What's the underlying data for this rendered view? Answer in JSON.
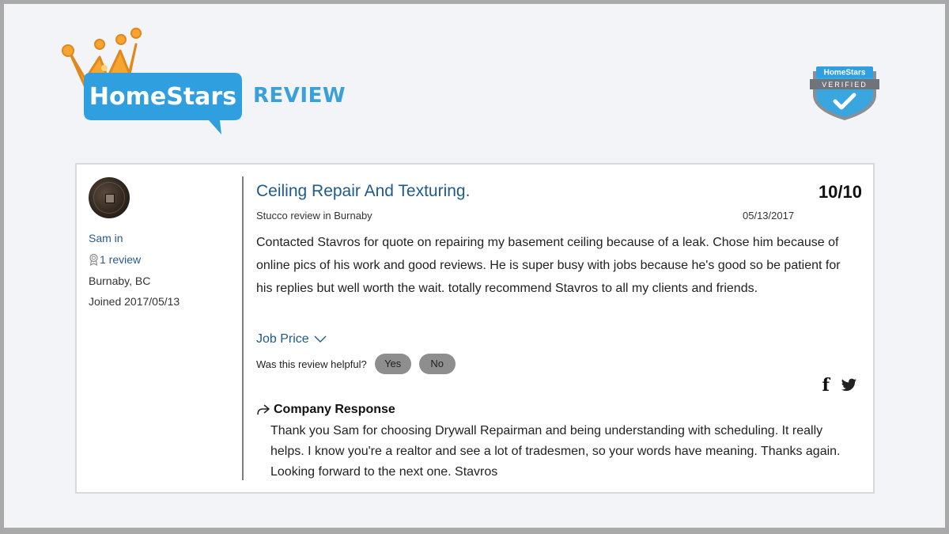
{
  "brand": {
    "logo_text": "HomeStars",
    "header_word": "REVIEW",
    "badge_top": "HomeStars",
    "badge_mid": "VERIFIED"
  },
  "reviewer": {
    "name": "Sam in",
    "review_count": "1 review",
    "location": "Burnaby, BC",
    "joined": "Joined 2017/05/13"
  },
  "review": {
    "title": "Ceiling Repair And Texturing.",
    "score": "10/10",
    "subline": "Stucco review in Burnaby",
    "date": "05/13/2017",
    "body": "Contacted Stavros for quote on repairing my basement ceiling because of a leak. Chose him because of online pics of his work and good reviews. He is super busy with jobs because he's good so be patient for his replies but well worth the wait. totally recommend Stavros to all my clients and friends.",
    "job_price_label": "Job Price",
    "helpful_question": "Was this review helpful?",
    "yes_label": "Yes",
    "no_label": "No",
    "share_facebook": "f"
  },
  "response": {
    "heading": "Company Response",
    "body": "Thank you Sam for choosing Drywall Repairman and being understanding with scheduling. It really helps. I know you're a realtor and see a lot of tradesmen, so your words have meaning. Thanks again. Looking forward to the next one. Stavros"
  },
  "colors": {
    "brand_blue": "#2f9fe0",
    "crown_orange": "#f7a531",
    "link_blue": "#1f5a8c",
    "pill_gray": "#8e8e8e"
  }
}
